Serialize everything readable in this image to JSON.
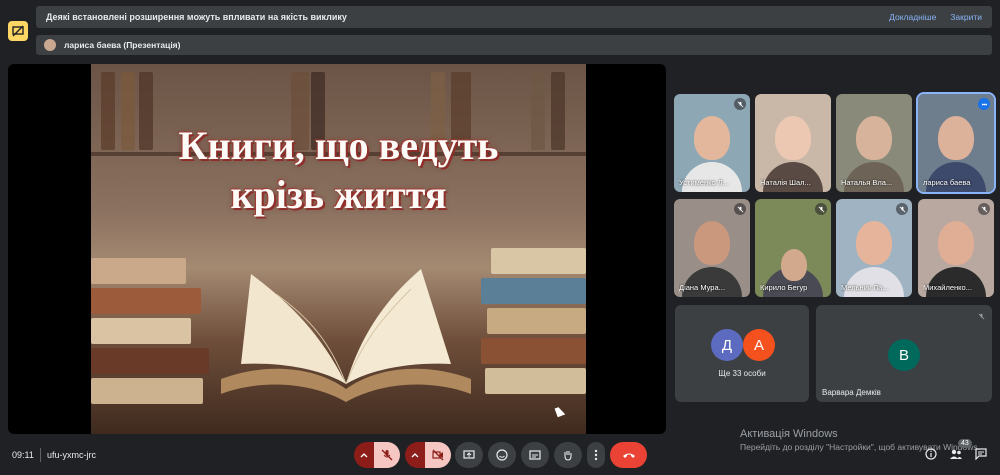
{
  "banner": {
    "message": "Деякі встановлені розширення можуть впливати на якість виклику",
    "details_label": "Докладніше",
    "close_label": "Закрити"
  },
  "presenter": {
    "label": "лариса баева (Презентація)"
  },
  "slide": {
    "title_line1": "Книги, що ведуть",
    "title_line2": "крізь життя"
  },
  "participants": [
    {
      "name": "Устименко Л...",
      "muted": true
    },
    {
      "name": "Наталія Шал...",
      "muted": false
    },
    {
      "name": "Наталья Вла...",
      "muted": false
    },
    {
      "name": "лариса баева",
      "muted": false,
      "speaking": true
    },
    {
      "name": "Діана Мура...",
      "muted": true
    },
    {
      "name": "Кирило Бегур",
      "muted": true
    },
    {
      "name": "Мельник Ла...",
      "muted": true
    },
    {
      "name": "Михайленко...",
      "muted": true
    }
  ],
  "others": {
    "avatar1": "Д",
    "avatar2": "А",
    "label": "Ще 33 особи",
    "color1": "#5c6bc0",
    "color2": "#f4511e"
  },
  "featured": {
    "initial": "В",
    "name": "Варвара Демків",
    "color": "#00695c"
  },
  "bottom": {
    "time": "09:11",
    "meeting_code": "ufu-yxmc-jrc",
    "people_count": "43"
  },
  "watermark": {
    "title": "Активація Windows",
    "subtitle": "Перейдіть до розділу \"Настройки\", щоб активувати Windows."
  },
  "icons": {
    "app": "presentation-icon",
    "mic": "mic-off-icon",
    "camera": "camera-off-icon",
    "present": "present-screen-icon",
    "emoji": "emoji-icon",
    "captions": "captions-icon",
    "hand": "raise-hand-icon",
    "more": "more-vert-icon",
    "end": "end-call-icon",
    "info": "info-icon",
    "people": "people-icon",
    "chat": "chat-icon"
  }
}
